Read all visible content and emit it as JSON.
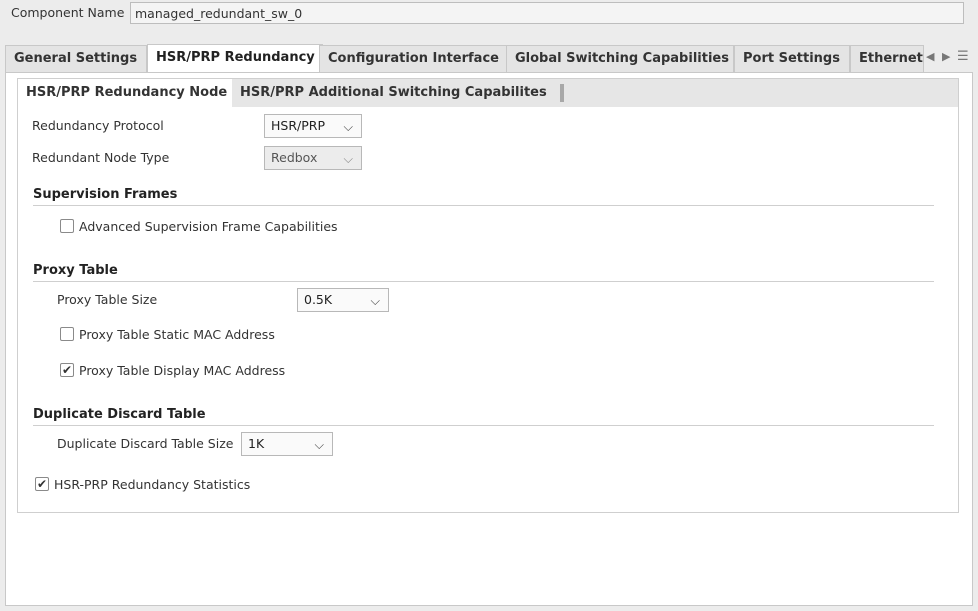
{
  "component": {
    "label": "Component Name",
    "value": "managed_redundant_sw_0"
  },
  "outer_tabs": [
    {
      "label": "General Settings"
    },
    {
      "label": "HSR/PRP Redundancy"
    },
    {
      "label": "Configuration Interface"
    },
    {
      "label": "Global Switching Capabilities"
    },
    {
      "label": "Port Settings"
    },
    {
      "label": "Ethernet"
    }
  ],
  "inner_tabs": [
    {
      "label": "HSR/PRP Redundancy Node"
    },
    {
      "label": "HSR/PRP Additional Switching Capabilites"
    }
  ],
  "redundancy": {
    "protocol_label": "Redundancy Protocol",
    "protocol_value": "HSR/PRP",
    "node_type_label": "Redundant Node Type",
    "node_type_value": "Redbox"
  },
  "supervision": {
    "title": "Supervision Frames",
    "advanced_label": "Advanced Supervision Frame Capabilities",
    "advanced_checked": false
  },
  "proxy": {
    "title": "Proxy Table",
    "size_label": "Proxy Table Size",
    "size_value": "0.5K",
    "static_mac_label": "Proxy Table Static MAC Address",
    "static_mac_checked": false,
    "display_mac_label": "Proxy Table Display MAC Address",
    "display_mac_checked": true
  },
  "duplicate": {
    "title": "Duplicate Discard Table",
    "size_label": "Duplicate Discard Table Size",
    "size_value": "1K"
  },
  "stats": {
    "label": "HSR-PRP Redundancy Statistics",
    "checked": true
  },
  "glyphs": {
    "chevron": "⌵",
    "check": "✔",
    "arrow_left": "◀",
    "arrow_right": "▶",
    "menu": "☰"
  }
}
